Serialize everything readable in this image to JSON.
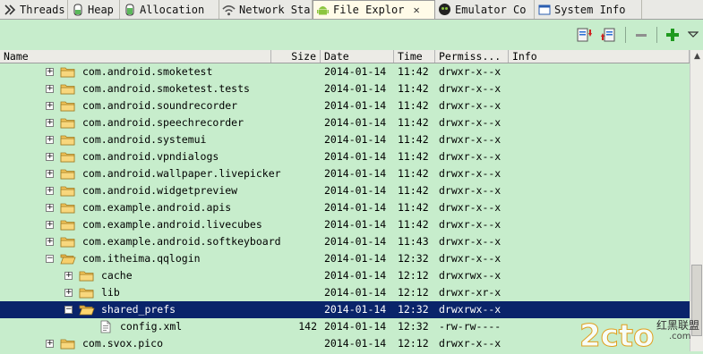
{
  "tabs": [
    {
      "label": "Threads",
      "icon": "threads-icon",
      "active": false
    },
    {
      "label": "Heap",
      "icon": "heap-icon",
      "active": false
    },
    {
      "label": "Allocation",
      "icon": "allocation-icon",
      "active": false
    },
    {
      "label": "Network Sta",
      "icon": "wifi-icon",
      "active": false
    },
    {
      "label": "File Explor",
      "icon": "android-icon",
      "active": true
    },
    {
      "label": "Emulator Co",
      "icon": "emulator-icon",
      "active": false
    },
    {
      "label": "System Info",
      "icon": "window-icon",
      "active": false
    }
  ],
  "columns": {
    "name": "Name",
    "size": "Size",
    "date": "Date",
    "time": "Time",
    "permissions": "Permiss...",
    "info": "Info"
  },
  "rows": [
    {
      "name": "com.android.smoketest",
      "size": "",
      "date": "2014-01-14",
      "time": "11:42",
      "perm": "drwxr-x--x",
      "indent": 0,
      "expanded": false,
      "type": "folder"
    },
    {
      "name": "com.android.smoketest.tests",
      "size": "",
      "date": "2014-01-14",
      "time": "11:42",
      "perm": "drwxr-x--x",
      "indent": 0,
      "expanded": false,
      "type": "folder"
    },
    {
      "name": "com.android.soundrecorder",
      "size": "",
      "date": "2014-01-14",
      "time": "11:42",
      "perm": "drwxr-x--x",
      "indent": 0,
      "expanded": false,
      "type": "folder"
    },
    {
      "name": "com.android.speechrecorder",
      "size": "",
      "date": "2014-01-14",
      "time": "11:42",
      "perm": "drwxr-x--x",
      "indent": 0,
      "expanded": false,
      "type": "folder"
    },
    {
      "name": "com.android.systemui",
      "size": "",
      "date": "2014-01-14",
      "time": "11:42",
      "perm": "drwxr-x--x",
      "indent": 0,
      "expanded": false,
      "type": "folder"
    },
    {
      "name": "com.android.vpndialogs",
      "size": "",
      "date": "2014-01-14",
      "time": "11:42",
      "perm": "drwxr-x--x",
      "indent": 0,
      "expanded": false,
      "type": "folder"
    },
    {
      "name": "com.android.wallpaper.livepicker",
      "size": "",
      "date": "2014-01-14",
      "time": "11:42",
      "perm": "drwxr-x--x",
      "indent": 0,
      "expanded": false,
      "type": "folder"
    },
    {
      "name": "com.android.widgetpreview",
      "size": "",
      "date": "2014-01-14",
      "time": "11:42",
      "perm": "drwxr-x--x",
      "indent": 0,
      "expanded": false,
      "type": "folder"
    },
    {
      "name": "com.example.android.apis",
      "size": "",
      "date": "2014-01-14",
      "time": "11:42",
      "perm": "drwxr-x--x",
      "indent": 0,
      "expanded": false,
      "type": "folder"
    },
    {
      "name": "com.example.android.livecubes",
      "size": "",
      "date": "2014-01-14",
      "time": "11:42",
      "perm": "drwxr-x--x",
      "indent": 0,
      "expanded": false,
      "type": "folder"
    },
    {
      "name": "com.example.android.softkeyboard",
      "size": "",
      "date": "2014-01-14",
      "time": "11:43",
      "perm": "drwxr-x--x",
      "indent": 0,
      "expanded": false,
      "type": "folder"
    },
    {
      "name": "com.itheima.qqlogin",
      "size": "",
      "date": "2014-01-14",
      "time": "12:32",
      "perm": "drwxr-x--x",
      "indent": 0,
      "expanded": true,
      "type": "folder"
    },
    {
      "name": "cache",
      "size": "",
      "date": "2014-01-14",
      "time": "12:12",
      "perm": "drwxrwx--x",
      "indent": 1,
      "expanded": false,
      "type": "folder"
    },
    {
      "name": "lib",
      "size": "",
      "date": "2014-01-14",
      "time": "12:12",
      "perm": "drwxr-xr-x",
      "indent": 1,
      "expanded": false,
      "type": "folder"
    },
    {
      "name": "shared_prefs",
      "size": "",
      "date": "2014-01-14",
      "time": "12:32",
      "perm": "drwxrwx--x",
      "indent": 1,
      "expanded": true,
      "type": "folder",
      "selected": true
    },
    {
      "name": "config.xml",
      "size": "142",
      "date": "2014-01-14",
      "time": "12:32",
      "perm": "-rw-rw----",
      "indent": 2,
      "expanded": false,
      "type": "file"
    },
    {
      "name": "com.svox.pico",
      "size": "",
      "date": "2014-01-14",
      "time": "12:12",
      "perm": "drwxr-x--x",
      "indent": 0,
      "expanded": false,
      "type": "folder"
    }
  ],
  "watermark": {
    "logo": "2cto",
    "sub": "红黑联盟",
    "sub_url": ".com"
  },
  "colors": {
    "background": "#c7edcc",
    "selection": "#0a246a",
    "folder": "#f3c55a"
  }
}
